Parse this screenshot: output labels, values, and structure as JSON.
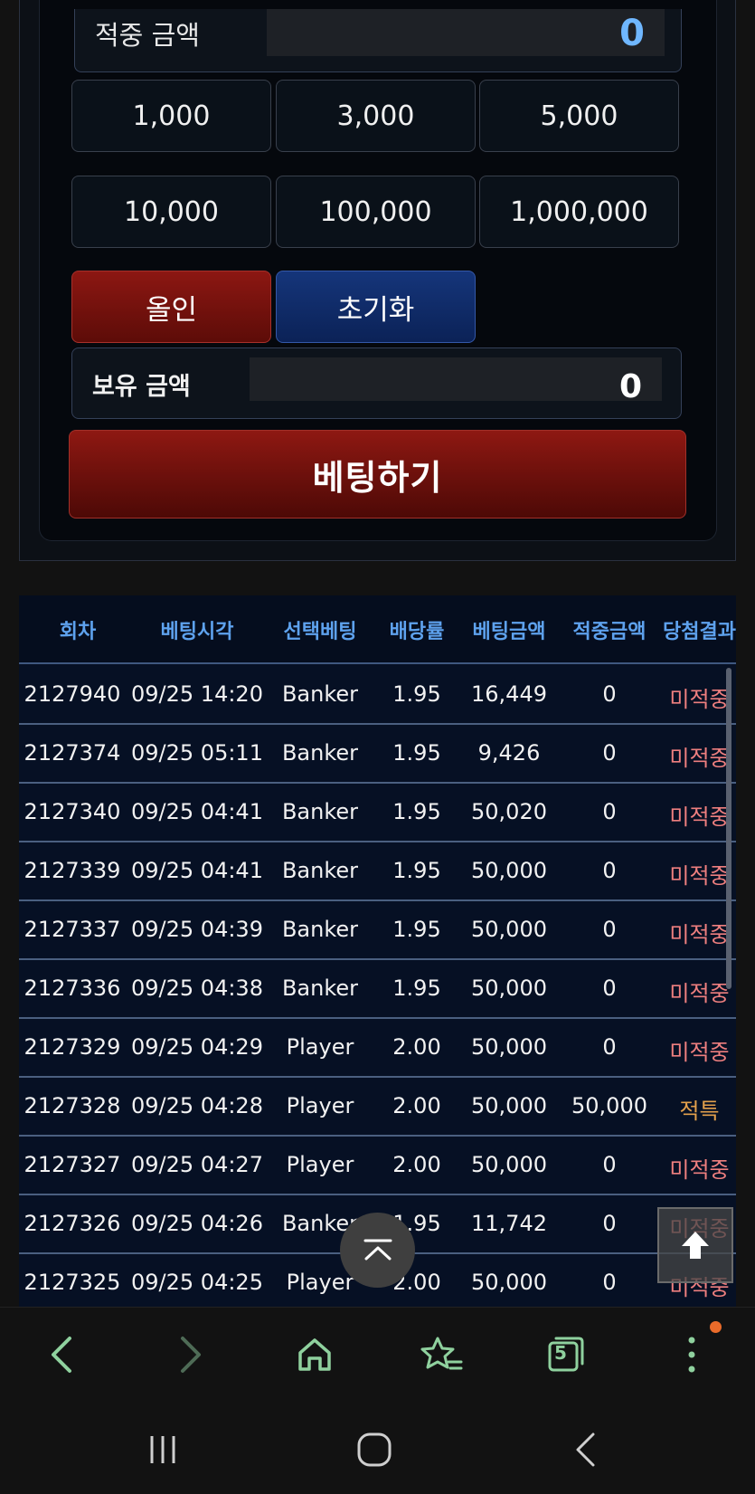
{
  "bet_panel": {
    "hit_amount_label": "적중 금액",
    "hit_amount_value": "0",
    "chips": [
      "1,000",
      "3,000",
      "5,000",
      "10,000",
      "100,000",
      "1,000,000"
    ],
    "allin_label": "올인",
    "reset_label": "초기화",
    "holding_label": "보유 금액",
    "holding_value": "0",
    "bet_button_label": "베팅하기"
  },
  "history": {
    "headers": [
      "회차",
      "베팅시각",
      "선택베팅",
      "배당률",
      "베팅금액",
      "적중금액",
      "당첨결과"
    ],
    "rows": [
      [
        "2127940",
        "09/25 14:20",
        "Banker",
        "1.95",
        "16,449",
        "0",
        "미적중"
      ],
      [
        "2127374",
        "09/25 05:11",
        "Banker",
        "1.95",
        "9,426",
        "0",
        "미적중"
      ],
      [
        "2127340",
        "09/25 04:41",
        "Banker",
        "1.95",
        "50,020",
        "0",
        "미적중"
      ],
      [
        "2127339",
        "09/25 04:41",
        "Banker",
        "1.95",
        "50,000",
        "0",
        "미적중"
      ],
      [
        "2127337",
        "09/25 04:39",
        "Banker",
        "1.95",
        "50,000",
        "0",
        "미적중"
      ],
      [
        "2127336",
        "09/25 04:38",
        "Banker",
        "1.95",
        "50,000",
        "0",
        "미적중"
      ],
      [
        "2127329",
        "09/25 04:29",
        "Player",
        "2.00",
        "50,000",
        "0",
        "미적중"
      ],
      [
        "2127328",
        "09/25 04:28",
        "Player",
        "2.00",
        "50,000",
        "50,000",
        "적특"
      ],
      [
        "2127327",
        "09/25 04:27",
        "Player",
        "2.00",
        "50,000",
        "0",
        "미적중"
      ],
      [
        "2127326",
        "09/25 04:26",
        "Banker",
        "1.95",
        "11,742",
        "0",
        "미적중"
      ],
      [
        "2127325",
        "09/25 04:25",
        "Player",
        "2.00",
        "50,000",
        "0",
        "미적중"
      ]
    ]
  },
  "colors": {
    "header_text": "#5ea2ee",
    "miss": "#ee7f7f",
    "hit_special": "#e3a04c",
    "browser_icon": "#8fd19e"
  },
  "icons": {
    "scroll_top": "double-up-chevron-icon",
    "page_up": "arrow-up-icon",
    "browser": [
      "back-icon",
      "forward-icon",
      "home-icon",
      "bookmarks-icon",
      "tabs-icon",
      "more-icon"
    ],
    "system": [
      "recents-icon",
      "home-circle-icon",
      "system-back-icon"
    ]
  },
  "browser": {
    "tab_count": "5"
  }
}
